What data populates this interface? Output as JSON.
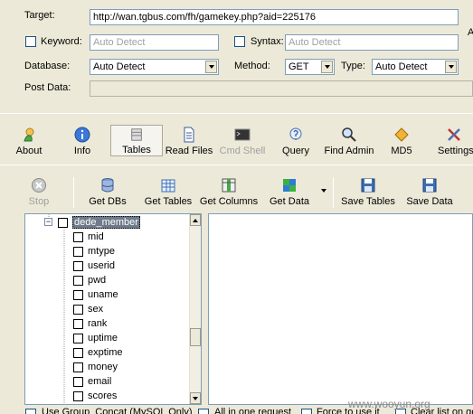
{
  "form": {
    "target_label": "Target:",
    "target_value": "http://wan.tgbus.com/fh/gamekey.php?aid=225176",
    "keyword_label": "Keyword:",
    "keyword_placeholder": "Auto Detect",
    "syntax_label": "Syntax:",
    "syntax_placeholder": "Auto Detect",
    "database_label": "Database:",
    "database_value": "Auto Detect",
    "method_label": "Method:",
    "method_value": "GET",
    "type_label": "Type:",
    "type_value": "Auto Detect",
    "postdata_label": "Post Data:",
    "edge_letter": "A"
  },
  "main_toolbar": [
    {
      "id": "about",
      "label": "About",
      "icon": "about-icon"
    },
    {
      "id": "info",
      "label": "Info",
      "icon": "info-icon"
    },
    {
      "id": "tables",
      "label": "Tables",
      "icon": "tables-icon",
      "selected": true
    },
    {
      "id": "readfiles",
      "label": "Read Files",
      "icon": "document-icon"
    },
    {
      "id": "cmdshell",
      "label": "Cmd Shell",
      "icon": "terminal-icon",
      "disabled": true
    },
    {
      "id": "query",
      "label": "Query",
      "icon": "query-icon"
    },
    {
      "id": "findadmin",
      "label": "Find Admin",
      "icon": "find-icon"
    },
    {
      "id": "md5",
      "label": "MD5",
      "icon": "md5-icon"
    },
    {
      "id": "settings",
      "label": "Settings",
      "icon": "settings-icon"
    }
  ],
  "sub_toolbar": [
    {
      "id": "stop",
      "label": "Stop",
      "icon": "stop-icon",
      "disabled": true
    },
    {
      "id": "getdbs",
      "label": "Get DBs",
      "icon": "database-icon"
    },
    {
      "id": "gettables",
      "label": "Get Tables",
      "icon": "table-icon"
    },
    {
      "id": "getcolumns",
      "label": "Get Columns",
      "icon": "columns-icon"
    },
    {
      "id": "getdata",
      "label": "Get Data",
      "icon": "grid-icon"
    },
    {
      "id": "savetables",
      "label": "Save Tables",
      "icon": "floppy-icon"
    },
    {
      "id": "savedata",
      "label": "Save Data",
      "icon": "floppy-icon"
    }
  ],
  "tree": {
    "table_name": "dede_member",
    "columns": [
      "mid",
      "mtype",
      "userid",
      "pwd",
      "uname",
      "sex",
      "rank",
      "uptime",
      "exptime",
      "money",
      "email",
      "scores"
    ]
  },
  "bottom": {
    "group_concat": "Use Group_Concat (MySQL Only)",
    "all_in_one": "All in one request",
    "force": "Force to use it",
    "clear": "Clear list on ge"
  },
  "watermark": "www.wooyun.org"
}
